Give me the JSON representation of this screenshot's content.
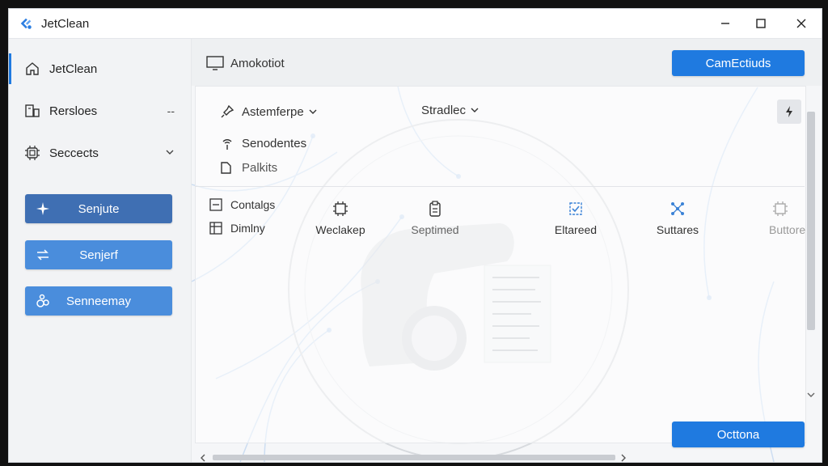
{
  "window": {
    "title": "JetClean",
    "controls": [
      "minimize",
      "maximize",
      "close"
    ]
  },
  "sidebar": {
    "items": [
      {
        "label": "JetClean",
        "icon": "home-icon",
        "active": true,
        "tail": ""
      },
      {
        "label": "Rersloes",
        "icon": "devices-icon",
        "tail": "--"
      },
      {
        "label": "Seccects",
        "icon": "chip-icon",
        "tail": "chevron-down"
      }
    ],
    "buttons": [
      {
        "label": "Senjute",
        "icon": "sparkle-icon",
        "color": "#3f6fb3"
      },
      {
        "label": "Senjerf",
        "icon": "transfer-icon",
        "color": "#4a8ddc"
      },
      {
        "label": "Senneemay",
        "icon": "gears-icon",
        "color": "#4a8ddc"
      }
    ]
  },
  "main": {
    "header": {
      "title": "Amokotiot",
      "icon": "monitor-icon"
    },
    "camp_button": "CamEctiuds",
    "bottom_button": "Octtona",
    "dropdowns": [
      {
        "label": "Astemferpe",
        "icon": "pin-icon"
      },
      {
        "label": "Stradlec"
      }
    ],
    "options": [
      {
        "label": "Senodentes",
        "icon": "signal-icon"
      },
      {
        "label": "Palkits",
        "icon": "folder-icon"
      }
    ],
    "small_items": [
      {
        "label": "Contalgs",
        "icon": "minus-box-icon"
      },
      {
        "label": "Dimlny",
        "icon": "grid-box-icon"
      }
    ],
    "tools": [
      {
        "label": "Weclakep",
        "icon": "chip-outline-icon",
        "color": "#333"
      },
      {
        "label": "Septimed",
        "icon": "clipboard-icon",
        "color": "#333"
      },
      {
        "label": "Eltareed",
        "icon": "check-chip-icon",
        "color": "#3b82d6"
      },
      {
        "label": "Suttares",
        "icon": "network-icon",
        "color": "#3b82d6"
      },
      {
        "label": "Buttore",
        "icon": "dim-chip-icon",
        "color": "#999"
      }
    ]
  },
  "colors": {
    "accent": "#1f7ae0",
    "sidebar_button_dark": "#3f6fb3",
    "sidebar_button_light": "#4a8ddc"
  }
}
